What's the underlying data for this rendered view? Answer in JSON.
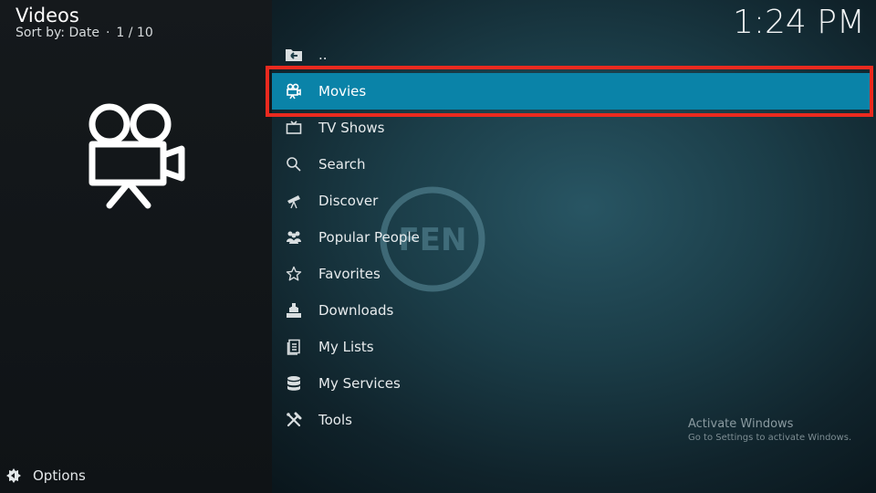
{
  "header": {
    "title": "Videos",
    "sort_label": "Sort by: Date",
    "separator": "·",
    "page_count": "1 / 10"
  },
  "clock": "1:24 PM",
  "menu": {
    "items": [
      {
        "label": "..",
        "icon": "folder-back-icon"
      },
      {
        "label": "Movies",
        "icon": "movie-camera-icon",
        "selected": true
      },
      {
        "label": "TV Shows",
        "icon": "tv-icon"
      },
      {
        "label": "Search",
        "icon": "search-icon"
      },
      {
        "label": "Discover",
        "icon": "telescope-icon"
      },
      {
        "label": "Popular People",
        "icon": "people-icon"
      },
      {
        "label": "Favorites",
        "icon": "star-icon"
      },
      {
        "label": "Downloads",
        "icon": "downloads-icon"
      },
      {
        "label": "My Lists",
        "icon": "list-icon"
      },
      {
        "label": "My Services",
        "icon": "database-icon"
      },
      {
        "label": "Tools",
        "icon": "tools-icon"
      }
    ]
  },
  "footer": {
    "options_label": "Options"
  },
  "watermark": {
    "logo_text": "FEN",
    "activate_title": "Activate Windows",
    "activate_subtitle": "Go to Settings to activate Windows."
  },
  "colors": {
    "selected_bg": "#0a83a8",
    "highlight_border": "#ea2a1f",
    "left_panel_bg": "#15191c",
    "right_panel_bg": "#1b3d48"
  }
}
